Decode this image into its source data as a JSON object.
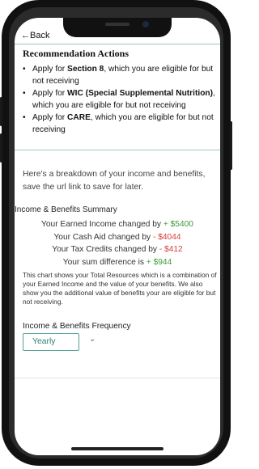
{
  "nav": {
    "back_label": "Back",
    "back_arrow": "←"
  },
  "recommendations": {
    "title": "Recommendation Actions",
    "items": [
      {
        "prefix": "Apply for ",
        "program": "Section 8",
        "suffix": ", which you are eligible for but not receiving"
      },
      {
        "prefix": "Apply for ",
        "program": "WIC (Special Supplemental Nutrition)",
        "suffix": ", which you are eligible for but not receiving"
      },
      {
        "prefix": "Apply for ",
        "program": "CARE",
        "suffix": ", which you are eligible for but not receiving"
      }
    ]
  },
  "breakdown": {
    "intro": "Here's a breakdown of your income and benefits, save the url link to save for later."
  },
  "summary": {
    "heading": "Income & Benefits Summary",
    "lines": [
      {
        "label": "Your Earned Income changed by ",
        "value": "+ $5400",
        "tone": "positive"
      },
      {
        "label": "Your Cash Aid changed by ",
        "value": "- $4044",
        "tone": "negative"
      },
      {
        "label": "Your Tax Credits changed by ",
        "value": "- $412",
        "tone": "negative"
      },
      {
        "label": "Your sum difference is ",
        "value": "+ $944",
        "tone": "positive"
      }
    ],
    "explanation": "This chart shows your Total Resources which is a combination of your Earned Income and the value of your benefits. We also show you the additional value of benefits your are eligible for but not receiving."
  },
  "frequency": {
    "label": "Income & Benefits Frequency",
    "selected": "Yearly",
    "chevron_icon": "chevron-down-icon"
  },
  "colors": {
    "positive": "#3b9b3b",
    "negative": "#d93b3b",
    "accent": "#54a196",
    "divider": "#9fc7c0"
  }
}
